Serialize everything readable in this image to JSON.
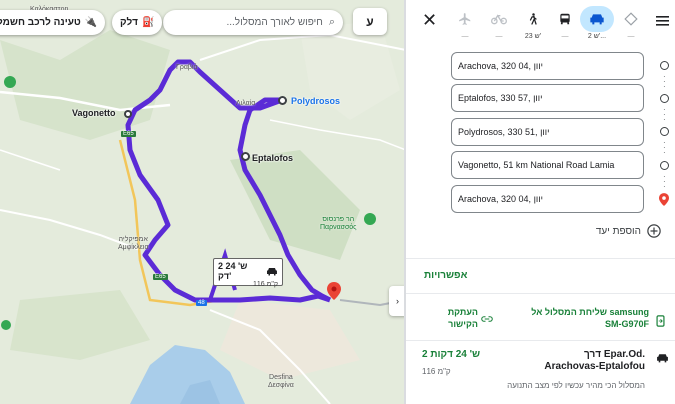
{
  "map": {
    "search_placeholder": "חיפוש לאורך המסלול...",
    "chip_fuel": "דלק",
    "chip_ev": "טעינה לרכב חשמלי",
    "chip_letter": "ע",
    "places": {
      "kalokastri": "Καλόκαστρη",
      "vagonetto": "Vagonetto",
      "polydrosos": "Polydrosos",
      "eptalofos": "Eptalofos",
      "amfikleia_he": "אמפיקליה",
      "amfikleia_gr": "Αμφίκλεια",
      "parnassos_he": "הר פרנסוס",
      "parnassos_gr": "Παρνασσός",
      "desfina_en": "Desfina",
      "desfina_gr": "Δεσφίνα",
      "lilaia": "Λιλαία",
      "drosochori_a": "Γραβιά"
    },
    "road_e65": "E65",
    "road_e65b": "E65",
    "road_48": "48",
    "route_label": {
      "time": "2 ש' 24 דק'",
      "dist": "116 ק\"מ"
    }
  },
  "panel": {
    "modes": [
      {
        "name": "best",
        "label": "—"
      },
      {
        "name": "car",
        "label": "2 ש'..."
      },
      {
        "name": "transit",
        "label": "—"
      },
      {
        "name": "walk",
        "label": "23 ש'"
      },
      {
        "name": "bike",
        "label": "—"
      },
      {
        "name": "flight",
        "label": "—"
      }
    ],
    "stops": [
      "Arachova, 320 04, יוון",
      "Eptalofos, 330 57, יוון",
      "Polydrosos, 330 51, יוון",
      "Vagonetto, 51 km National Road Lamia",
      "Arachova, 320 04, יוון"
    ],
    "add_stop": "הוספת יעד",
    "options": "אפשרויות",
    "send_route": "שליחת המסלול אל samsung SM-G970F",
    "copy_link": "העתקת הקישור",
    "route": {
      "title": "דרך Epar.Od. Arachovas-Eptalofou",
      "time": "2 ש' 24 דקות",
      "dist": "116 ק\"מ",
      "subtitle": "המסלול הכי מהיר עכשיו לפי מצב התנועה"
    }
  },
  "colors": {
    "route": "#5b2bd6",
    "active_mode": "#c2e7ff",
    "accent_green": "#188038",
    "destination": "#ea4335"
  }
}
